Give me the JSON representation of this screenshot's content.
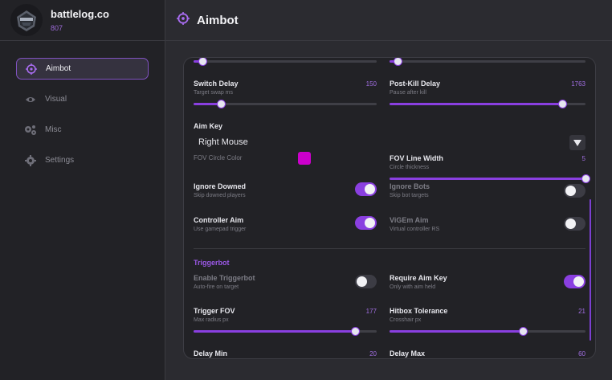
{
  "brand": {
    "name": "battlelog.co",
    "sub": "807"
  },
  "header": {
    "title": "Aimbot"
  },
  "nav": [
    {
      "label": "Aimbot",
      "icon": "crosshair-icon",
      "active": true
    },
    {
      "label": "Visual",
      "icon": "eye-icon",
      "active": false
    },
    {
      "label": "Misc",
      "icon": "gears-icon",
      "active": false
    },
    {
      "label": "Settings",
      "icon": "gear-icon",
      "active": false
    }
  ],
  "settings": {
    "top_left_slider": {
      "value": 0.05
    },
    "top_right_slider": {
      "value": 0.04
    },
    "switch_delay": {
      "label": "Switch Delay",
      "desc": "Target swap ms",
      "value": "150",
      "fraction": 0.15
    },
    "post_kill_delay": {
      "label": "Post-Kill Delay",
      "desc": "Pause after kill",
      "value": "1763",
      "fraction": 0.88
    },
    "aim_key": {
      "label": "Aim Key",
      "value": "Right Mouse"
    },
    "fov_circle_color": {
      "label": "FOV Circle Color",
      "color": "#cc00cc"
    },
    "fov_line_width": {
      "label": "FOV Line Width",
      "desc": "Circle thickness",
      "value": "5",
      "fraction": 1.0
    },
    "ignore_downed": {
      "label": "Ignore Downed",
      "desc": "Skip downed players",
      "on": true
    },
    "ignore_bots": {
      "label": "Ignore Bots",
      "desc": "Skip bot targets",
      "on": false
    },
    "controller_aim": {
      "label": "Controller Aim",
      "desc": "Use gamepad trigger",
      "on": true
    },
    "vigem_aim": {
      "label": "ViGEm Aim",
      "desc": "Virtual controller RS",
      "on": false
    },
    "triggerbot_section": "Triggerbot",
    "enable_triggerbot": {
      "label": "Enable Triggerbot",
      "desc": "Auto-fire on target",
      "on": false
    },
    "require_aim_key": {
      "label": "Require Aim Key",
      "desc": "Only with aim held",
      "on": true
    },
    "trigger_fov": {
      "label": "Trigger FOV",
      "desc": "Max radius px",
      "value": "177",
      "fraction": 0.88
    },
    "hitbox_tolerance": {
      "label": "Hitbox Tolerance",
      "desc": "Crosshair px",
      "value": "21",
      "fraction": 0.68
    },
    "delay_min": {
      "label": "Delay Min",
      "value": "20"
    },
    "delay_max": {
      "label": "Delay Max",
      "value": "60"
    }
  },
  "colors": {
    "accent": "#8a3fe0",
    "background": "#2b2b30",
    "panel": "#222226"
  }
}
